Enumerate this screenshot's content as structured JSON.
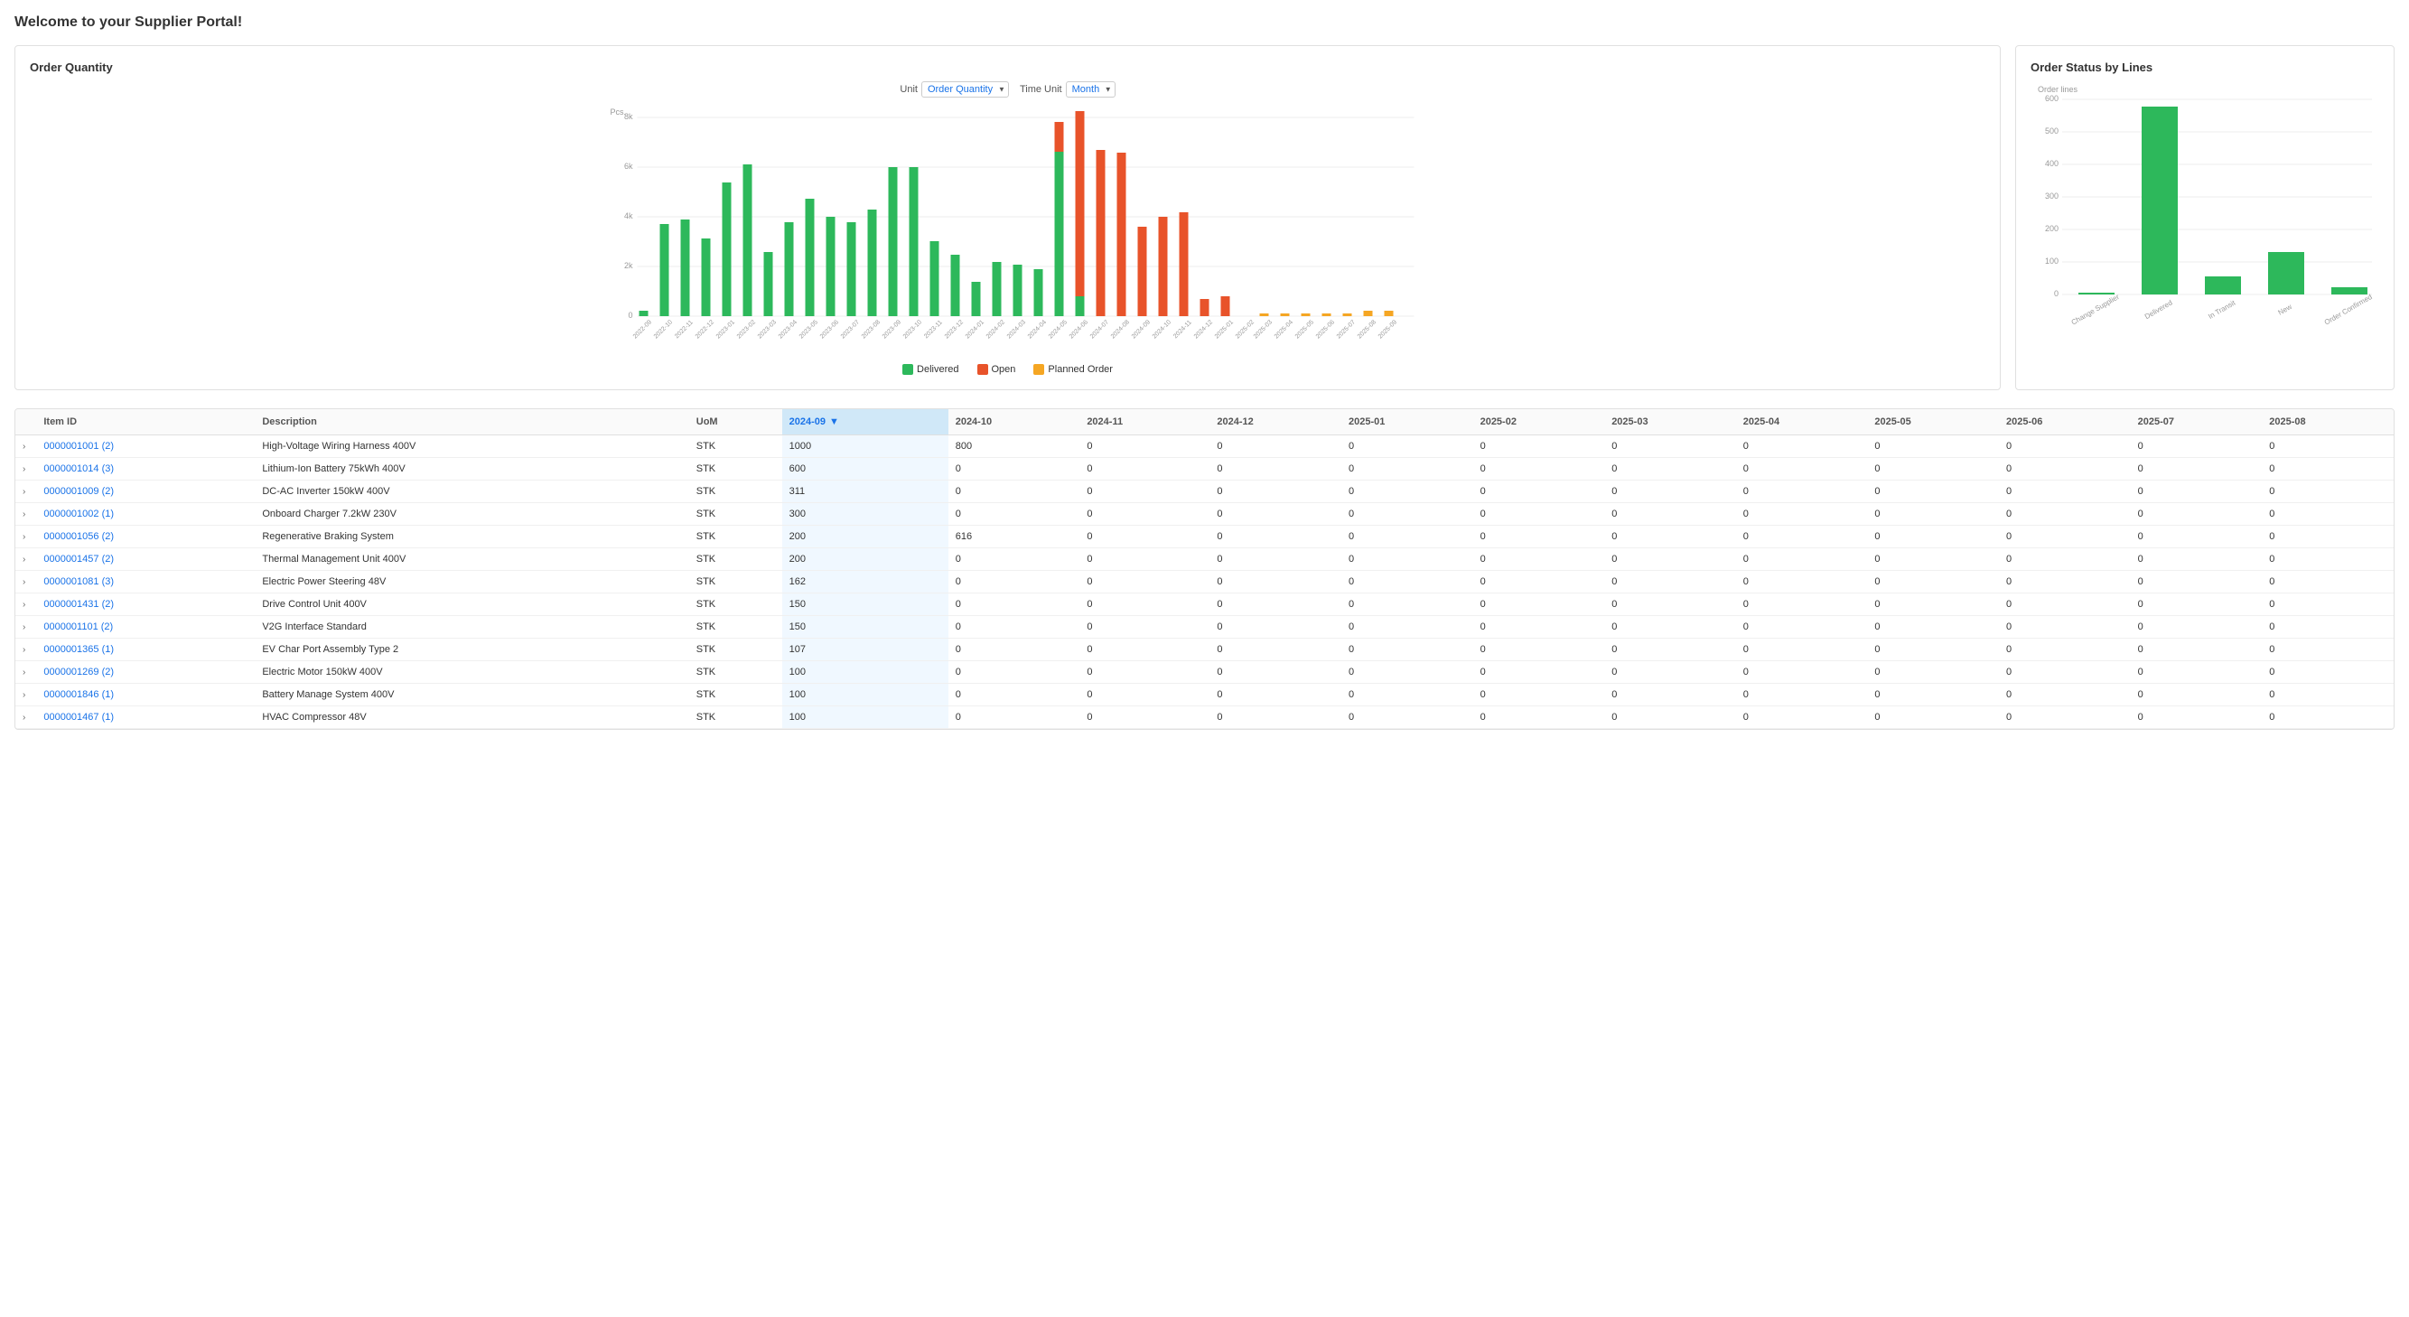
{
  "page": {
    "title": "Welcome to your Supplier Portal!"
  },
  "controls": {
    "unit_label": "Unit",
    "unit_value": "Order Quantity",
    "timeunit_label": "Time Unit",
    "timeunit_value": "Month"
  },
  "order_quantity_chart": {
    "title": "Order Quantity",
    "y_label": "Pcs.",
    "y_ticks": [
      "8k",
      "6k",
      "4k",
      "2k",
      "0"
    ],
    "legend": [
      {
        "label": "Delivered",
        "color": "#2db85b"
      },
      {
        "label": "Open",
        "color": "#e8532a"
      },
      {
        "label": "Planned Order",
        "color": "#f5a623"
      }
    ],
    "bars": [
      {
        "month": "2022-09",
        "delivered": 200,
        "open": 0,
        "planned": 0
      },
      {
        "month": "2022-10",
        "delivered": 3700,
        "open": 0,
        "planned": 0
      },
      {
        "month": "2022-11",
        "delivered": 3900,
        "open": 0,
        "planned": 0
      },
      {
        "month": "2022-12",
        "delivered": 3100,
        "open": 0,
        "planned": 0
      },
      {
        "month": "2023-01",
        "delivered": 5400,
        "open": 0,
        "planned": 0
      },
      {
        "month": "2023-02",
        "delivered": 6100,
        "open": 0,
        "planned": 0
      },
      {
        "month": "2023-03",
        "delivered": 2600,
        "open": 0,
        "planned": 0
      },
      {
        "month": "2023-04",
        "delivered": 3800,
        "open": 0,
        "planned": 0
      },
      {
        "month": "2023-05",
        "delivered": 4700,
        "open": 0,
        "planned": 0
      },
      {
        "month": "2023-06",
        "delivered": 4000,
        "open": 0,
        "planned": 0
      },
      {
        "month": "2023-07",
        "delivered": 3800,
        "open": 0,
        "planned": 0
      },
      {
        "month": "2023-08",
        "delivered": 4300,
        "open": 0,
        "planned": 0
      },
      {
        "month": "2023-09",
        "delivered": 6000,
        "open": 0,
        "planned": 0
      },
      {
        "month": "2023-10",
        "delivered": 6000,
        "open": 0,
        "planned": 0
      },
      {
        "month": "2023-11",
        "delivered": 3000,
        "open": 0,
        "planned": 0
      },
      {
        "month": "2023-12",
        "delivered": 2500,
        "open": 0,
        "planned": 0
      },
      {
        "month": "2024-01",
        "delivered": 1400,
        "open": 0,
        "planned": 0
      },
      {
        "month": "2024-02",
        "delivered": 2200,
        "open": 0,
        "planned": 0
      },
      {
        "month": "2024-03",
        "delivered": 2100,
        "open": 0,
        "planned": 0
      },
      {
        "month": "2024-04",
        "delivered": 1900,
        "open": 0,
        "planned": 0
      },
      {
        "month": "2024-05",
        "delivered": 6600,
        "open": 1200,
        "planned": 0
      },
      {
        "month": "2024-06",
        "delivered": 800,
        "open": 7500,
        "planned": 0
      },
      {
        "month": "2024-07",
        "delivered": 0,
        "open": 6700,
        "planned": 0
      },
      {
        "month": "2024-08",
        "delivered": 0,
        "open": 6600,
        "planned": 0
      },
      {
        "month": "2024-09",
        "delivered": 0,
        "open": 3600,
        "planned": 0
      },
      {
        "month": "2024-10",
        "delivered": 0,
        "open": 4000,
        "planned": 0
      },
      {
        "month": "2024-11",
        "delivered": 0,
        "open": 4200,
        "planned": 0
      },
      {
        "month": "2024-12",
        "delivered": 0,
        "open": 700,
        "planned": 0
      },
      {
        "month": "2025-01",
        "delivered": 0,
        "open": 800,
        "planned": 0
      },
      {
        "month": "2025-02",
        "delivered": 0,
        "open": 0,
        "planned": 0
      },
      {
        "month": "2025-03",
        "delivered": 0,
        "open": 0,
        "planned": 100
      },
      {
        "month": "2025-04",
        "delivered": 0,
        "open": 0,
        "planned": 100
      },
      {
        "month": "2025-05",
        "delivered": 0,
        "open": 0,
        "planned": 100
      },
      {
        "month": "2025-06",
        "delivered": 0,
        "open": 0,
        "planned": 100
      },
      {
        "month": "2025-07",
        "delivered": 0,
        "open": 0,
        "planned": 100
      },
      {
        "month": "2025-08",
        "delivered": 0,
        "open": 0,
        "planned": 200
      },
      {
        "month": "2025-09",
        "delivered": 0,
        "open": 0,
        "planned": 200
      }
    ]
  },
  "order_status_chart": {
    "title": "Order Status by Lines",
    "y_label": "Order lines",
    "y_ticks": [
      "600",
      "500",
      "400",
      "300",
      "200",
      "100",
      "0"
    ],
    "bars": [
      {
        "label": "Change Supplier",
        "value": 5,
        "color": "#2db85b"
      },
      {
        "label": "Delivered",
        "value": 580,
        "color": "#2db85b"
      },
      {
        "label": "In Transit",
        "value": 55,
        "color": "#2db85b"
      },
      {
        "label": "New",
        "value": 130,
        "color": "#2db85b"
      },
      {
        "label": "Order Confirmed",
        "value": 22,
        "color": "#2db85b"
      }
    ]
  },
  "table": {
    "active_col": "2024-09",
    "columns": [
      "Item ID",
      "Description",
      "UoM",
      "2024-09",
      "2024-10",
      "2024-11",
      "2024-12",
      "2025-01",
      "2025-02",
      "2025-03",
      "2025-04",
      "2025-05",
      "2025-06",
      "2025-07",
      "2025-08"
    ],
    "rows": [
      {
        "id": "0000001001 (2)",
        "desc": "High-Voltage Wiring Harness 400V",
        "uom": "STK",
        "vals": [
          1000,
          800,
          0,
          0,
          0,
          0,
          0,
          0,
          0,
          0,
          0,
          0
        ]
      },
      {
        "id": "0000001014 (3)",
        "desc": "Lithium-Ion Battery 75kWh 400V",
        "uom": "STK",
        "vals": [
          600,
          0,
          0,
          0,
          0,
          0,
          0,
          0,
          0,
          0,
          0,
          0
        ]
      },
      {
        "id": "0000001009 (2)",
        "desc": "DC-AC Inverter 150kW 400V",
        "uom": "STK",
        "vals": [
          311,
          0,
          0,
          0,
          0,
          0,
          0,
          0,
          0,
          0,
          0,
          0
        ]
      },
      {
        "id": "0000001002 (1)",
        "desc": "Onboard Charger 7.2kW 230V",
        "uom": "STK",
        "vals": [
          300,
          0,
          0,
          0,
          0,
          0,
          0,
          0,
          0,
          0,
          0,
          0
        ]
      },
      {
        "id": "0000001056 (2)",
        "desc": "Regenerative Braking System",
        "uom": "STK",
        "vals": [
          200,
          616,
          0,
          0,
          0,
          0,
          0,
          0,
          0,
          0,
          0,
          0
        ]
      },
      {
        "id": "0000001457 (2)",
        "desc": "Thermal Management Unit 400V",
        "uom": "STK",
        "vals": [
          200,
          0,
          0,
          0,
          0,
          0,
          0,
          0,
          0,
          0,
          0,
          0
        ]
      },
      {
        "id": "0000001081 (3)",
        "desc": "Electric Power Steering 48V",
        "uom": "STK",
        "vals": [
          162,
          0,
          0,
          0,
          0,
          0,
          0,
          0,
          0,
          0,
          0,
          0
        ]
      },
      {
        "id": "0000001431 (2)",
        "desc": "Drive Control Unit 400V",
        "uom": "STK",
        "vals": [
          150,
          0,
          0,
          0,
          0,
          0,
          0,
          0,
          0,
          0,
          0,
          0
        ]
      },
      {
        "id": "0000001101 (2)",
        "desc": "V2G Interface Standard",
        "uom": "STK",
        "vals": [
          150,
          0,
          0,
          0,
          0,
          0,
          0,
          0,
          0,
          0,
          0,
          0
        ]
      },
      {
        "id": "0000001365 (1)",
        "desc": "EV Char Port Assembly Type 2",
        "uom": "STK",
        "vals": [
          107,
          0,
          0,
          0,
          0,
          0,
          0,
          0,
          0,
          0,
          0,
          0
        ]
      },
      {
        "id": "0000001269 (2)",
        "desc": "Electric Motor 150kW 400V",
        "uom": "STK",
        "vals": [
          100,
          0,
          0,
          0,
          0,
          0,
          0,
          0,
          0,
          0,
          0,
          0
        ]
      },
      {
        "id": "0000001846 (1)",
        "desc": "Battery Manage System 400V",
        "uom": "STK",
        "vals": [
          100,
          0,
          0,
          0,
          0,
          0,
          0,
          0,
          0,
          0,
          0,
          0
        ]
      },
      {
        "id": "0000001467 (1)",
        "desc": "HVAC Compressor 48V",
        "uom": "STK",
        "vals": [
          100,
          0,
          0,
          0,
          0,
          0,
          0,
          0,
          0,
          0,
          0,
          0
        ]
      }
    ]
  }
}
